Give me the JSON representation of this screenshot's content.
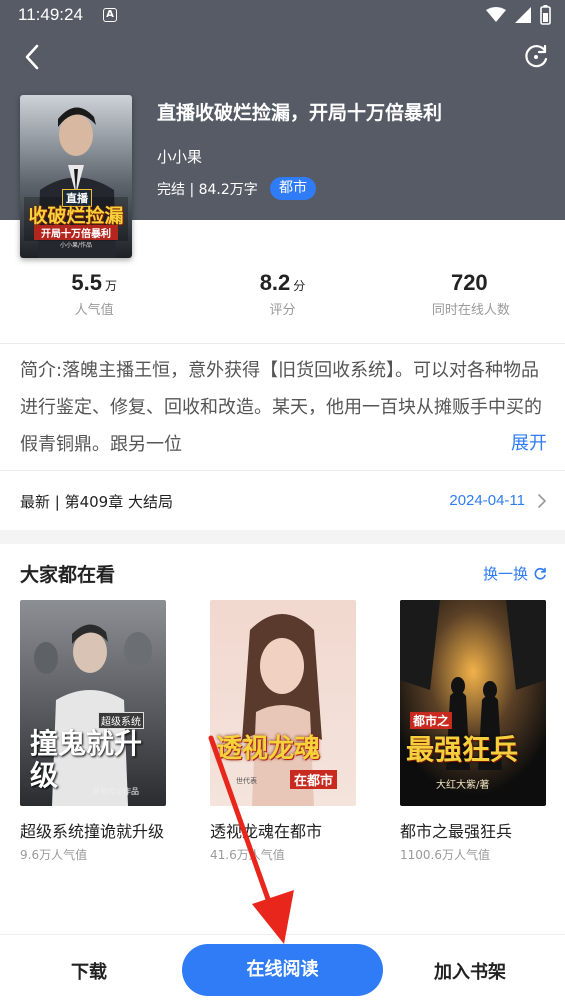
{
  "status_bar": {
    "time": "11:49:24",
    "notification_glyph": "A",
    "icons": [
      "wifi-icon",
      "signal-icon",
      "battery-icon"
    ]
  },
  "book": {
    "title": "直播收破烂捡漏，开局十万倍暴利",
    "author": "小小果",
    "meta": "完结 | 84.2万字",
    "genre": "都市",
    "cover_text": {
      "badge": "直播",
      "main": "收破烂捡漏",
      "sub": "开局十万倍暴利",
      "author_credit": "小小果/作品"
    }
  },
  "stats": [
    {
      "value": "5.5",
      "unit": "万",
      "label": "人气值"
    },
    {
      "value": "8.2",
      "unit": "分",
      "label": "评分"
    },
    {
      "value": "720",
      "unit": "",
      "label": "同时在线人数"
    }
  ],
  "intro": {
    "text": "简介:落魄主播王恒，意外获得【旧货回收系统】。可以对各种物品进行鉴定、修复、回收和改造。某天，他用一百块从摊贩手中买的假青铜鼎。跟另一位",
    "expand_label": "展开"
  },
  "latest": {
    "label": "最新 | 第409章 大结局",
    "date": "2024-04-11"
  },
  "recommend": {
    "title": "大家都在看",
    "swap_label": "换一换",
    "items": [
      {
        "name": "超级系统撞诡就升级",
        "popularity": "9.6万人气值",
        "cover_main": "撞鬼就升级",
        "cover_badge": "超级系统",
        "cover_author": "萧旬号◎作品"
      },
      {
        "name": "透视龙魂在都市",
        "popularity": "41.6万人气值",
        "cover_main": "透视龙魂",
        "cover_sub": "在都市",
        "cover_author": "世代表"
      },
      {
        "name": "都市之最强狂兵",
        "popularity": "1100.6万人气值",
        "cover_badge": "都市之",
        "cover_main": "最强狂兵",
        "cover_author": "大红大紫/著"
      }
    ]
  },
  "bottom_bar": {
    "download": "下载",
    "read_online": "在线阅读",
    "add_to_shelf": "加入书架"
  },
  "colors": {
    "header_bg": "#565b66",
    "accent": "#2f7cf6",
    "annotation_arrow": "#e8261c"
  }
}
